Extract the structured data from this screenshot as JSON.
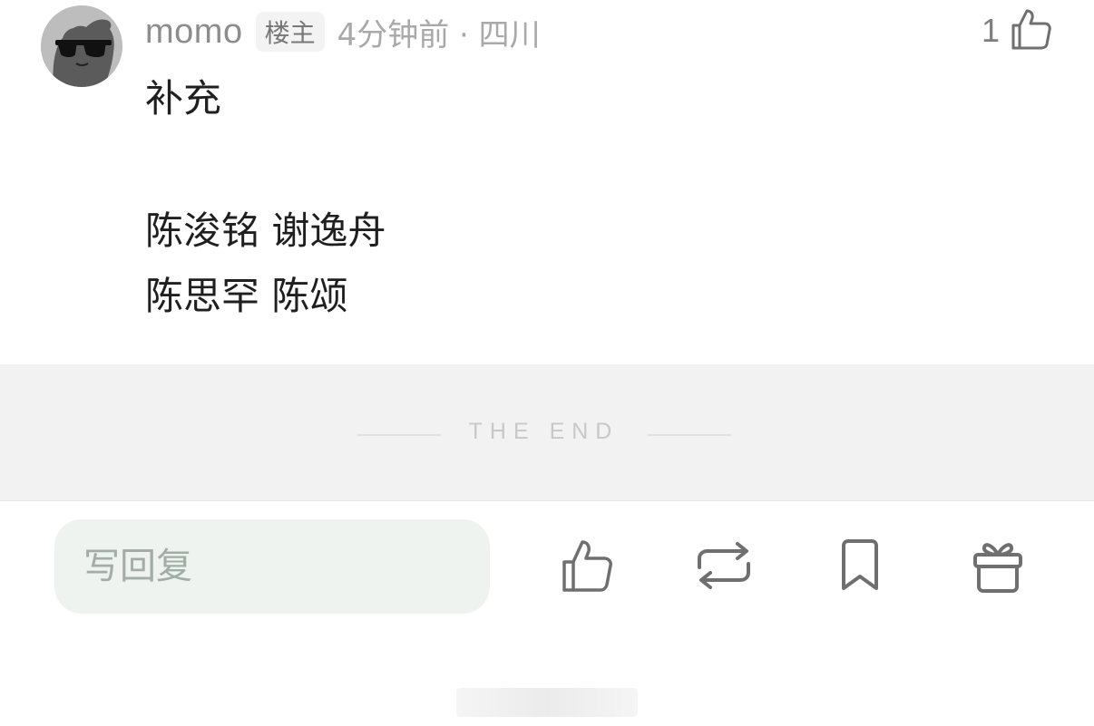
{
  "comment": {
    "username": "momo",
    "badge": "楼主",
    "time_location": "4分钟前 · 四川",
    "like_count": "1",
    "body": {
      "line1": "补充",
      "line2": "陈浚铭 谢逸舟",
      "line3": "陈思罕 陈颂"
    }
  },
  "end_section": {
    "text": "THE END"
  },
  "bottom_bar": {
    "reply_placeholder": "写回复",
    "actions": [
      {
        "icon": "thumbs-up-icon"
      },
      {
        "icon": "repost-icon"
      },
      {
        "icon": "bookmark-icon"
      },
      {
        "icon": "gift-icon"
      }
    ]
  },
  "colors": {
    "icon_gray": "#6f6f6f",
    "end_background": "#f2f2f2",
    "reply_background": "#eef3ef"
  }
}
